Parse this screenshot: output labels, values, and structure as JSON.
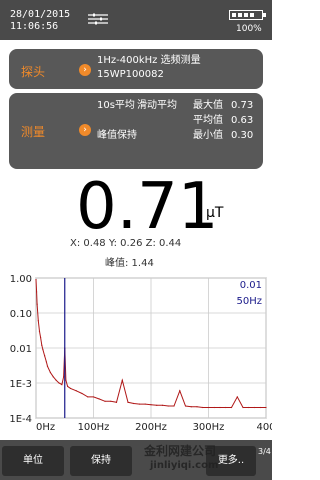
{
  "status": {
    "date": "28/01/2015",
    "time": "11:06:56",
    "battery_pct_label": "100%",
    "battery_level": 0.8
  },
  "probe": {
    "label": "探头",
    "line1": "1Hz-400kHz 选频测量",
    "line2": "15WP100082"
  },
  "measure": {
    "label": "测量",
    "avg_mode": "10s平均",
    "sliding": "滑动平均",
    "peak_hold": "峰值保持",
    "max_label": "最大值",
    "max_value": "0.73",
    "avg_label": "平均值",
    "avg_value": "0.63",
    "min_label": "最小值",
    "min_value": "0.30"
  },
  "reading": {
    "value": "0.71",
    "unit": "μT",
    "xyz": "X: 0.48  Y: 0.26  Z: 0.44",
    "peak": "峰值: 1.44"
  },
  "chart_data": {
    "type": "line",
    "x_tick_labels": [
      "0Hz",
      "100Hz",
      "200Hz",
      "300Hz",
      "400"
    ],
    "y_tick_labels": [
      "1.00",
      "0.10",
      "0.01",
      "1E-3",
      "1E-4"
    ],
    "ylim": [
      0.0001,
      1
    ],
    "xlim": [
      0,
      400
    ],
    "y_scale": "log",
    "grid": true,
    "cursor": {
      "freq": 50,
      "value_label": "0.01",
      "freq_label": "50Hz"
    },
    "series": [
      {
        "color": "#b01818",
        "x": [
          0,
          1,
          2,
          4,
          6,
          8,
          10,
          12,
          15,
          18,
          20,
          25,
          30,
          35,
          40,
          45,
          48,
          50,
          52,
          55,
          60,
          70,
          80,
          90,
          100,
          110,
          120,
          130,
          140,
          150,
          160,
          170,
          180,
          190,
          200,
          210,
          220,
          230,
          240,
          250,
          260,
          270,
          280,
          290,
          300,
          310,
          320,
          330,
          340,
          350,
          360,
          370,
          380,
          390,
          400
        ],
        "values": [
          0.9,
          0.4,
          0.18,
          0.06,
          0.03,
          0.02,
          0.012,
          0.009,
          0.006,
          0.004,
          0.003,
          0.002,
          0.0015,
          0.0012,
          0.001,
          0.0009,
          0.0015,
          0.01,
          0.0012,
          0.0008,
          0.0007,
          0.0006,
          0.0005,
          0.0004,
          0.0004,
          0.00035,
          0.0003,
          0.0003,
          0.00028,
          0.0012,
          0.00028,
          0.00026,
          0.00025,
          0.00025,
          0.00024,
          0.00023,
          0.00023,
          0.00022,
          0.00022,
          0.0006,
          0.00022,
          0.00021,
          0.00021,
          0.0002,
          0.0002,
          0.0002,
          0.0002,
          0.0002,
          0.0002,
          0.0004,
          0.0002,
          0.0002,
          0.0002,
          0.0002,
          0.0002
        ]
      }
    ]
  },
  "buttons": {
    "unit": "单位",
    "hold": "保持",
    "more": "更多..",
    "page": "3/4"
  },
  "watermark": {
    "line1": "金利网建公司",
    "line2": "jinliyiqi.com"
  }
}
